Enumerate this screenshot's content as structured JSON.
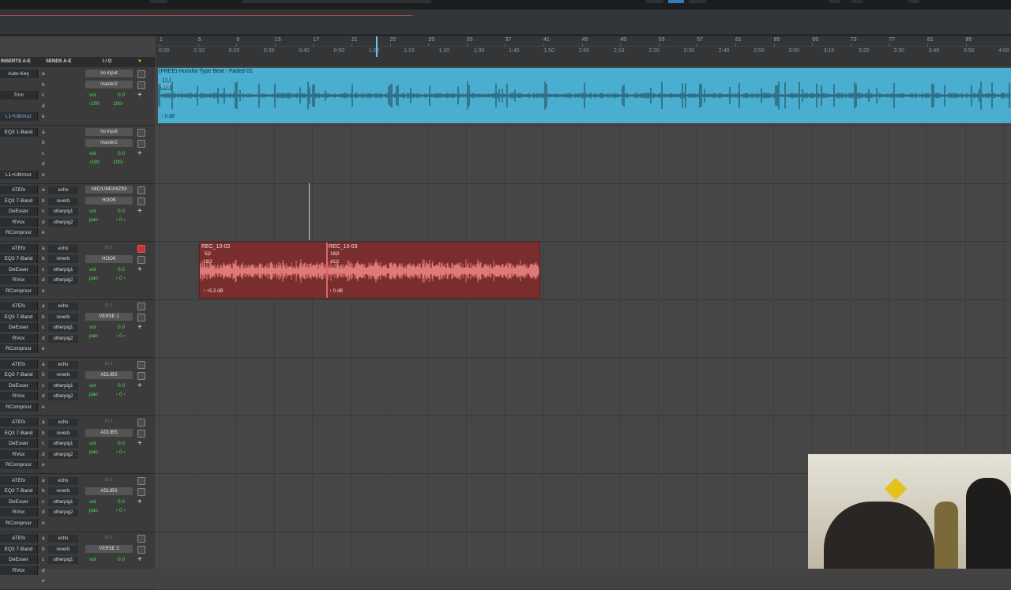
{
  "headers": {
    "inserts": "INSERTS A-E",
    "sends": "SENDS A-E",
    "io": "I / O"
  },
  "ruler": {
    "bars": [
      "1",
      "5",
      "9",
      "13",
      "17",
      "21",
      "25",
      "29",
      "33",
      "37",
      "41",
      "45",
      "49",
      "53",
      "57",
      "61",
      "65",
      "69",
      "73",
      "77",
      "81",
      "85"
    ],
    "times": [
      "0:00",
      "0:10",
      "0:20",
      "0:30",
      "0:40",
      "0:50",
      "1:00",
      "1:10",
      "1:20",
      "1:30",
      "1:40",
      "1:50",
      "2:00",
      "2:10",
      "2:20",
      "2:30",
      "2:40",
      "2:50",
      "3:00",
      "3:10",
      "3:20",
      "3:30",
      "3:40",
      "3:50",
      "4:00"
    ]
  },
  "tracks": [
    {
      "inserts": [
        "Auto-Key",
        "",
        "Trim",
        "",
        "L1+Ultrmxz"
      ],
      "inserts_blue": [
        false,
        false,
        false,
        false,
        true
      ],
      "sends": [
        "",
        "",
        "",
        "",
        ""
      ],
      "io_in": "no input",
      "io_out": "master2",
      "vol_label": "vol",
      "vol": "0.0",
      "pan_l": "‹100",
      "pan_r": "100›",
      "slots": [
        "a",
        "b",
        "c",
        "d",
        "e"
      ],
      "record": false
    },
    {
      "inserts": [
        "EQ3 1-Band",
        "",
        "",
        "",
        "L1+Ultrmxz"
      ],
      "inserts_blue": [
        false,
        false,
        false,
        false,
        false
      ],
      "sends": [
        "",
        "",
        "",
        "",
        ""
      ],
      "io_in": "no input",
      "io_out": "master2",
      "vol_label": "vol",
      "vol": "0.0",
      "pan_l": "‹100",
      "pan_r": "100›",
      "slots": [
        "a",
        "b",
        "c",
        "d",
        "e"
      ],
      "record": false
    },
    {
      "inserts": [
        "ATEfx",
        "EQ3 7-Band",
        "DeEsser",
        "RVox",
        "RComprssr"
      ],
      "inserts_blue": [
        false,
        false,
        false,
        false,
        false
      ],
      "sends": [
        "echo",
        "reverb",
        "otherpig1",
        "otherpig2",
        ""
      ],
      "io_in": "MIC/LINE/HIZ/M",
      "io_out": "HOOK",
      "vol_label": "vol",
      "vol": "0.0",
      "pan_label": "pan",
      "pan": "‹ 0 ›",
      "slots": [
        "a",
        "b",
        "c",
        "d",
        "e"
      ],
      "record": false
    },
    {
      "inserts": [
        "ATEfx",
        "EQ3 7-Band",
        "DeEsser",
        "RVox",
        "RComprssr"
      ],
      "inserts_blue": [
        false,
        false,
        false,
        false,
        false
      ],
      "sends": [
        "echo",
        "reverb",
        "otherpig1",
        "otherpig2",
        ""
      ],
      "io_in": "In 1",
      "io_out": "HOOK",
      "vol_label": "vol",
      "vol": "0.0",
      "pan_label": "pan",
      "pan": "‹ 0 ›",
      "slots": [
        "a",
        "b",
        "c",
        "d",
        "e"
      ],
      "record": true
    },
    {
      "inserts": [
        "ATEfx",
        "EQ3 7-Band",
        "DeEsser",
        "RVox",
        "RComprssr"
      ],
      "inserts_blue": [
        false,
        false,
        false,
        false,
        false
      ],
      "sends": [
        "echo",
        "reverb",
        "otherpig1",
        "otherpig2",
        ""
      ],
      "io_in": "In 1",
      "io_out": "VERSE 1",
      "vol_label": "vol",
      "vol": "0.0",
      "pan_label": "pan",
      "pan": "‹ 0 ›",
      "slots": [
        "a",
        "b",
        "c",
        "d",
        "e"
      ],
      "record": false
    },
    {
      "inserts": [
        "ATEfx",
        "EQ3 7-Band",
        "DeEsser",
        "RVox",
        "RComprssr"
      ],
      "inserts_blue": [
        false,
        false,
        false,
        false,
        false
      ],
      "sends": [
        "echo",
        "reverb",
        "otherpig1",
        "otherpig2",
        ""
      ],
      "io_in": "In 1",
      "io_out": "ADLIBS",
      "vol_label": "vol",
      "vol": "0.0",
      "pan_label": "pan",
      "pan": "‹ 0 ›",
      "slots": [
        "a",
        "b",
        "c",
        "d",
        "e"
      ],
      "record": false
    },
    {
      "inserts": [
        "ATEfx",
        "EQ3 7-Band",
        "DeEsser",
        "RVox",
        "RComprssr"
      ],
      "inserts_blue": [
        false,
        false,
        false,
        false,
        false
      ],
      "sends": [
        "echo",
        "reverb",
        "otherpig1",
        "otherpig2",
        ""
      ],
      "io_in": "In 1",
      "io_out": "ADLIBS",
      "vol_label": "vol",
      "vol": "0.0",
      "pan_label": "pan",
      "pan": "‹ 0 ›",
      "slots": [
        "a",
        "b",
        "c",
        "d",
        "e"
      ],
      "record": false
    },
    {
      "inserts": [
        "ATEfx",
        "EQ3 7-Band",
        "DeEsser",
        "RVox",
        "RComprssr"
      ],
      "inserts_blue": [
        false,
        false,
        false,
        false,
        false
      ],
      "sends": [
        "echo",
        "reverb",
        "otherpig1",
        "otherpig2",
        ""
      ],
      "io_in": "In 1",
      "io_out": "ADLIBS",
      "vol_label": "vol",
      "vol": "0.0",
      "pan_label": "pan",
      "pan": "‹ 0 ›",
      "slots": [
        "a",
        "b",
        "c",
        "d",
        "e"
      ],
      "record": false
    },
    {
      "inserts": [
        "ATEfx",
        "EQ3 7-Band",
        "DeEsser",
        "RVox",
        ""
      ],
      "inserts_blue": [
        false,
        false,
        false,
        false,
        false
      ],
      "sends": [
        "echo",
        "reverb",
        "otherpig1",
        "",
        ""
      ],
      "io_in": "In 1",
      "io_out": "VERSE 2",
      "vol_label": "vol",
      "vol": "0.0",
      "pan_label": "",
      "pan": "",
      "slots": [
        "a",
        "b",
        "c",
        "d",
        "e"
      ],
      "record": false
    }
  ],
  "clips": {
    "beat": {
      "name": "(FREE) Hunxho Type Beat - Faded-01",
      "pos1": "1|1",
      "pos2": "97|1",
      "gain": "↑ 0 dB"
    },
    "rec_a": {
      "name": "REC_10-02",
      "pos1": "5|2",
      "pos2": "18|3",
      "gain": "↑ +5.2 dB"
    },
    "rec_b": {
      "name": "REC_10-03",
      "pos1": "18|3",
      "pos2": "41|1",
      "gain": "↑ 0 dB"
    }
  },
  "colors": {
    "beat_clip": "#4aaed0",
    "vocal_clip": "#7a2d2d",
    "vocal_wave": "#e07a7a",
    "record_button": "#cc3333"
  },
  "webcam": {
    "sign_text": ""
  }
}
